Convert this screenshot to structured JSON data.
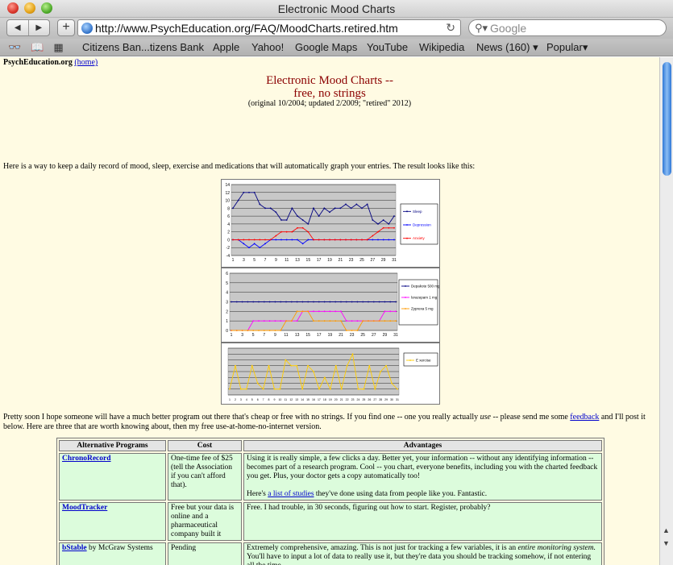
{
  "window": {
    "title": "Electronic Mood Charts"
  },
  "toolbar": {
    "url": "http://www.PsychEducation.org/FAQ/MoodCharts.retired.htm",
    "search_placeholder": "Google",
    "back_icon": "back-arrow-icon",
    "forward_icon": "forward-arrow-icon",
    "add_label": "+",
    "reload_icon": "reload-icon"
  },
  "bookmarks": [
    "Citizens Ban...tizens Bank",
    "Apple",
    "Yahoo!",
    "Google Maps",
    "YouTube",
    "Wikipedia",
    "News (160)",
    "Popular"
  ],
  "page": {
    "site_name": "PsychEducation.org",
    "home_link": "(home)",
    "title_line1": "Electronic Mood Charts --",
    "title_line2": "free, no strings",
    "subtitle": "(original 10/2004; updated 2/2009; \"retired\" 2012)",
    "intro": "Here is a way to keep a daily record of mood, sleep, exercise and medications that will automatically graph your entries. The result looks like this:",
    "para_before_feedback": "Pretty soon I hope someone will have a much better program out there that's cheap or free with no strings. If you find one -- one you really actually ",
    "para_use": "use",
    "para_mid": " -- please send me some ",
    "feedback_link": "feedback",
    "para_after": " and I'll post it below. Here are three that are worth knowing about, then my free use-at-home-no-internet version.",
    "accent_color": "#8b0000",
    "background_color": "#fffbe3",
    "cell_color": "#dcfcdc"
  },
  "table": {
    "headers": [
      "Alternative Programs",
      "Cost",
      "Advantages"
    ],
    "rows": [
      {
        "program": "ChronoRecord",
        "program_suffix": "",
        "cost": "One-time fee of $25 (tell the Association if you can't afford that).",
        "advantages": "Using it is really simple, a few clicks a day. Better yet, your information -- without any identifying information -- becomes part of a research program. Cool -- you chart, everyone benefits, including you with the charted feedback you get. Plus, your doctor gets a copy automatically too!",
        "extra_prefix": "Here's ",
        "extra_link": "a list of studies",
        "extra_suffix": " they've done using data from people like you. Fantastic."
      },
      {
        "program": "MoodTracker",
        "program_suffix": "",
        "cost": "Free but your data is online and a pharmaceutical company built it",
        "advantages": "Free. I had trouble, in 30 seconds, figuring out how to start. Register, probably?"
      },
      {
        "program": "bStable",
        "program_suffix": " by McGraw Systems",
        "cost": "Pending",
        "adv_before": "Extremely comprehensive, amazing. This is not just for tracking a few variables, it is an ",
        "adv_em": "entire monitoring system.",
        "adv_after": " You'll have to input a lot of data to really use it, but they're data you should be tracking somehow, if not entering all the time."
      }
    ]
  },
  "chart_data": [
    {
      "type": "line",
      "x": [
        1,
        2,
        3,
        4,
        5,
        6,
        7,
        8,
        9,
        10,
        11,
        12,
        13,
        14,
        15,
        16,
        17,
        18,
        19,
        20,
        21,
        22,
        23,
        24,
        25,
        26,
        27,
        28,
        29,
        30,
        31
      ],
      "xticks": [
        "1",
        "3",
        "5",
        "7",
        "9",
        "11",
        "13",
        "15",
        "17",
        "19",
        "21",
        "23",
        "25",
        "27",
        "29",
        "31"
      ],
      "ylim": [
        -4,
        14
      ],
      "yticks": [
        "-4",
        "-2",
        "0",
        "2",
        "4",
        "6",
        "8",
        "10",
        "12",
        "14"
      ],
      "series": [
        {
          "name": "Sleep",
          "color": "#000080",
          "values": [
            8,
            10,
            12,
            12,
            12,
            9,
            8,
            8,
            7,
            5,
            5,
            8,
            6,
            5,
            4,
            8,
            6,
            8,
            7,
            8,
            8,
            9,
            8,
            9,
            8,
            9,
            5,
            4,
            5,
            4,
            6
          ]
        },
        {
          "name": "Depression",
          "color": "#0000ff",
          "values": [
            0,
            0,
            -1,
            -2,
            -1,
            -2,
            -1,
            0,
            0,
            0,
            0,
            0,
            0,
            -1,
            0,
            0,
            0,
            0,
            0,
            0,
            0,
            0,
            0,
            0,
            0,
            0,
            0,
            0,
            0,
            0,
            0
          ]
        },
        {
          "name": "Anxiety",
          "color": "#ff0000",
          "values": [
            0,
            0,
            0,
            0,
            0,
            0,
            0,
            0,
            1,
            2,
            2,
            2,
            3,
            3,
            2,
            0,
            0,
            0,
            0,
            0,
            0,
            0,
            0,
            0,
            0,
            0,
            1,
            2,
            3,
            3,
            3
          ]
        }
      ],
      "grid": true,
      "legend": "right"
    },
    {
      "type": "line",
      "x": [
        1,
        2,
        3,
        4,
        5,
        6,
        7,
        8,
        9,
        10,
        11,
        12,
        13,
        14,
        15,
        16,
        17,
        18,
        19,
        20,
        21,
        22,
        23,
        24,
        25,
        26,
        27,
        28,
        29,
        30,
        31
      ],
      "xticks": [
        "1",
        "3",
        "5",
        "7",
        "9",
        "11",
        "13",
        "15",
        "17",
        "19",
        "21",
        "23",
        "25",
        "27",
        "29",
        "31"
      ],
      "ylim": [
        0,
        6
      ],
      "yticks": [
        "0",
        "1",
        "2",
        "3",
        "4",
        "5",
        "6"
      ],
      "series": [
        {
          "name": "Depakote 500 mg ER",
          "color": "#000080",
          "values": [
            3,
            3,
            3,
            3,
            3,
            3,
            3,
            3,
            3,
            3,
            3,
            3,
            3,
            3,
            3,
            3,
            3,
            3,
            3,
            3,
            3,
            3,
            3,
            3,
            3,
            3,
            3,
            3,
            3,
            3,
            3
          ]
        },
        {
          "name": "lorazepam 1 mg",
          "color": "#ff00ff",
          "values": [
            0,
            0,
            0,
            0,
            1,
            1,
            1,
            1,
            1,
            1,
            1,
            1,
            1,
            2,
            2,
            2,
            2,
            2,
            2,
            2,
            2,
            1,
            1,
            1,
            1,
            1,
            1,
            1,
            2,
            2,
            2
          ]
        },
        {
          "name": "Zyprexa 5 mg",
          "color": "#ff9900",
          "values": [
            0,
            0,
            0,
            0,
            0,
            0,
            0,
            0,
            0,
            0,
            1,
            1,
            2,
            2,
            2,
            1,
            1,
            1,
            1,
            1,
            1,
            0,
            0,
            0,
            1,
            1,
            1,
            1,
            1,
            1,
            1
          ]
        }
      ],
      "grid": true,
      "legend": "right"
    },
    {
      "type": "line",
      "x": [
        1,
        2,
        3,
        4,
        5,
        6,
        7,
        8,
        9,
        10,
        11,
        12,
        13,
        14,
        15,
        16,
        17,
        18,
        19,
        20,
        21,
        22,
        23,
        24,
        25,
        26,
        27,
        28,
        29,
        30,
        31
      ],
      "ylim": [
        0,
        8
      ],
      "series": [
        {
          "name": "E xercise",
          "color": "#ffcc00",
          "values": [
            1,
            5,
            1,
            1,
            5,
            2,
            1,
            5,
            1,
            1,
            6,
            5,
            5,
            1,
            5,
            4,
            1,
            3,
            1,
            5,
            1,
            5,
            7,
            1,
            1,
            5,
            1,
            4,
            5,
            2,
            1
          ]
        }
      ],
      "grid": true,
      "legend": "right"
    }
  ]
}
